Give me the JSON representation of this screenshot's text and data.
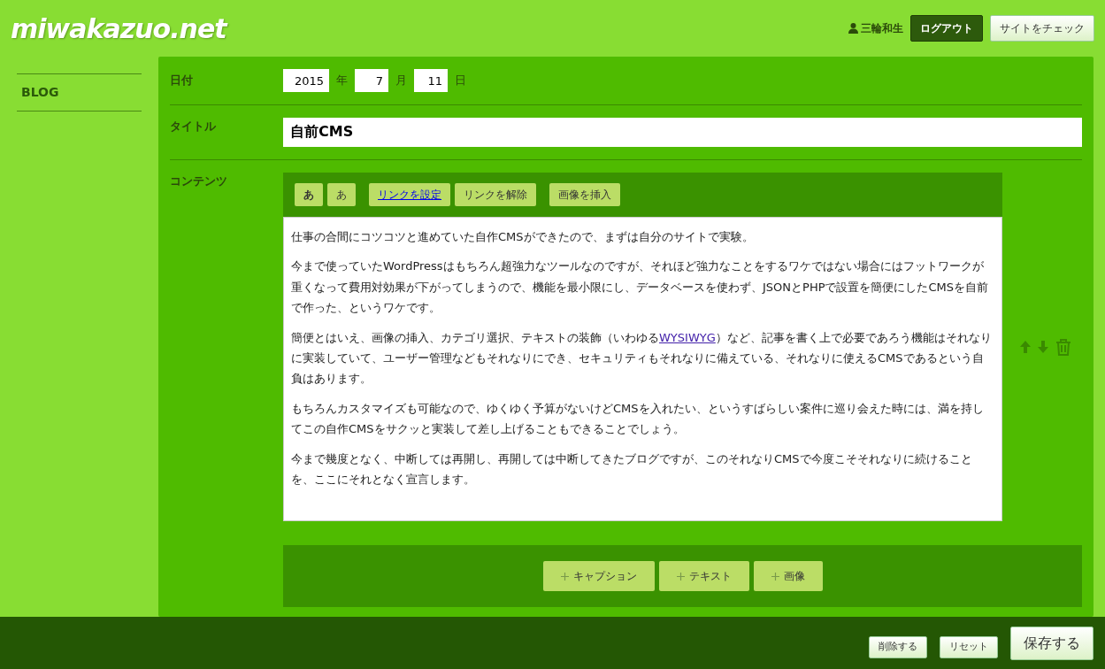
{
  "site": {
    "logo": "miwakazuo.net",
    "user": "三輪和生",
    "logout": "ログアウト",
    "check_site": "サイトをチェック"
  },
  "sidebar": {
    "items": [
      {
        "label": "BLOG",
        "selected": true
      }
    ]
  },
  "date": {
    "label": "日付",
    "year": "2015",
    "year_unit": "年",
    "month": "7",
    "month_unit": "月",
    "day": "11",
    "day_unit": "日"
  },
  "title": {
    "label": "タイトル",
    "value": "自前CMS"
  },
  "content": {
    "label": "コンテンツ",
    "toolbar": [
      {
        "label": "あ",
        "kind": "bold"
      },
      {
        "label": "あ",
        "kind": "normal"
      },
      {
        "label": "リンクを設定",
        "kind": "link"
      },
      {
        "label": "リンクを解除",
        "kind": "normal"
      },
      {
        "label": "画像を挿入",
        "kind": "normal"
      }
    ],
    "paragraphs": [
      {
        "text": "仕事の合間にコツコツと進めていた自作CMSができたので、まずは自分のサイトで実験。"
      },
      {
        "text": "今まで使っていたWordPressはもちろん超強力なツールなのですが、それほど強力なことをするワケではない場合にはフットワークが重くなって費用対効果が下がってしまうので、機能を最小限にし、データベースを使わず、JSONとPHPで設置を簡便にしたCMSを自前で作った、というワケです。"
      },
      {
        "text": "簡便とはいえ、画像の挿入、カテゴリ選択、テキストの装飾（いわゆる",
        "link": "WYSIWYG",
        "after": "）など、記事を書く上で必要であろう機能はそれなりに実装していて、ユーザー管理などもそれなりにでき、セキュリティもそれなりに備えている、それなりに使えるCMSであるという自負はあります。"
      },
      {
        "text": "もちろんカスタマイズも可能なので、ゆくゆく予算がないけどCMSを入れたい、というすばらしい案件に巡り会えた時には、満を持してこの自作CMSをサクッと実装して差し上げることもできることでしょう。"
      },
      {
        "text": "今まで幾度となく、中断しては再開し、再開しては中断してきたブログですが、このそれなりCMSで今度こそそれなりに続けることを、ここにそれとなく宣言します。"
      }
    ]
  },
  "add_buttons": [
    "キャプション",
    "テキスト",
    "画像"
  ],
  "footer": {
    "delete": "削除する",
    "reset": "リセット",
    "save": "保存する"
  }
}
